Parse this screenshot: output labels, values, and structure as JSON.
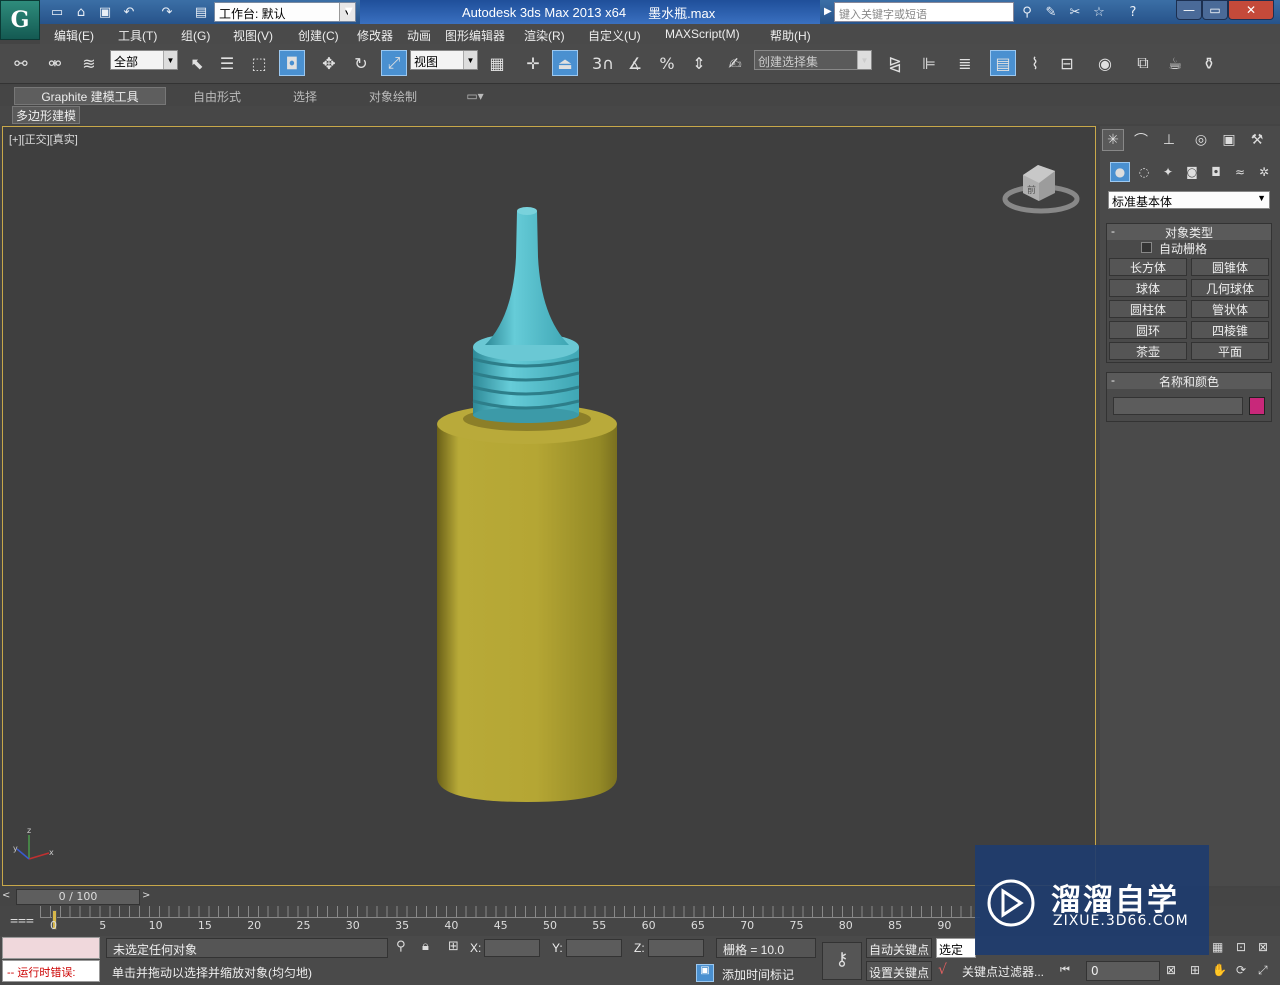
{
  "titlebar": {
    "workspace_label": "工作台: 默认",
    "app_title": "Autodesk 3ds Max  2013 x64",
    "file_name": "墨水瓶.max",
    "search_placeholder": "键入关键字或短语"
  },
  "menu": [
    "编辑(E)",
    "工具(T)",
    "组(G)",
    "视图(V)",
    "创建(C)",
    "修改器",
    "动画",
    "图形编辑器",
    "渲染(R)",
    "自定义(U)",
    "MAXScript(M)",
    "帮助(H)"
  ],
  "toolbar": {
    "selection_filter": "全部",
    "reference_coord": "视图",
    "named_selection": "创建选择集",
    "snap_label": "3"
  },
  "ribbon": {
    "tabs": [
      "Graphite 建模工具",
      "自由形式",
      "选择",
      "对象绘制"
    ],
    "sub_tab": "多边形建模"
  },
  "viewport": {
    "label_plus": "[+]",
    "label_view": "[正交]",
    "label_shading": "[真实]",
    "viewcube_face": "前",
    "axis_x": "x",
    "axis_y": "y",
    "axis_z": "z"
  },
  "command_panel": {
    "category": "标准基本体",
    "object_type_title": "对象类型",
    "autogrid_label": "自动栅格",
    "buttons": [
      "长方体",
      "圆锥体",
      "球体",
      "几何球体",
      "圆柱体",
      "管状体",
      "圆环",
      "四棱锥",
      "茶壶",
      "平面"
    ],
    "name_color_title": "名称和颜色",
    "name_value": "",
    "swatch_color": "#c8287a"
  },
  "timeline": {
    "frame_display": "0 / 100",
    "ticks": [
      "0",
      "5",
      "10",
      "15",
      "20",
      "25",
      "30",
      "35",
      "40",
      "45",
      "50",
      "55",
      "60",
      "65",
      "70",
      "75",
      "80",
      "85",
      "90"
    ]
  },
  "statusbar": {
    "maxscript_error": "-- 运行时错误:",
    "selection_status": "未选定任何对象",
    "prompt": "单击并拖动以选择并缩放对象(均匀地)",
    "x_label": "X:",
    "y_label": "Y:",
    "z_label": "Z:",
    "grid": "栅格 = 10.0",
    "auto_key": "自动关键点",
    "set_key": "设置关键点",
    "selected_dropdown": "选定对",
    "key_filters": "关键点过滤器...",
    "add_time_tag": "添加时间标记",
    "frame_value": "0"
  },
  "watermark": {
    "brand": "溜溜自学",
    "url": "ZIXUE.3D66.COM"
  },
  "colors": {
    "bottle_body": "#b0a232",
    "bottle_cap": "#5cc4d0",
    "viewport_border": "#c8a84a"
  }
}
